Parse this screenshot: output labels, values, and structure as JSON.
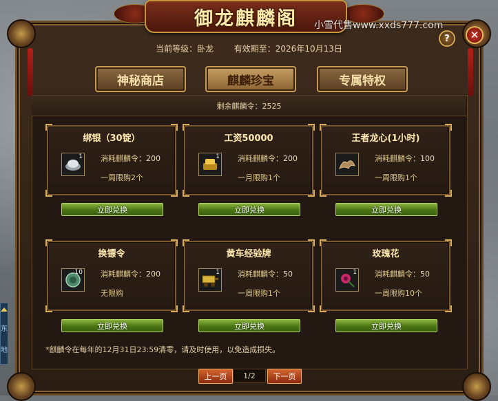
{
  "window": {
    "title": "御龙麒麟阁",
    "watermark": "小雪代售www.xxds777.com",
    "help_label": "?",
    "close_label": "✕"
  },
  "header": {
    "level_label": "当前等级：卧龙",
    "expiry_label": "有效期至：2026年10月13日"
  },
  "tabs": [
    {
      "label": "神秘商店",
      "active": false
    },
    {
      "label": "麒麟珍宝",
      "active": true
    },
    {
      "label": "专属特权",
      "active": false
    }
  ],
  "remaining": "剩余麒麟令：2525",
  "cost_prefix": "消耗麒麟令：",
  "exchange_label": "立即兑换",
  "items": [
    {
      "name": "绑银（30锭）",
      "cost": "200",
      "limit": "一周限购2个",
      "qty": "1",
      "icon": "silver-ingot-icon",
      "color": "#c9cfd6"
    },
    {
      "name": "工资50000",
      "cost": "200",
      "limit": "一月限购1个",
      "qty": "1",
      "icon": "gold-ingot-icon",
      "color": "#e2b53a"
    },
    {
      "name": "王者龙心(1小时)",
      "cost": "100",
      "limit": "一周限购1个",
      "qty": "",
      "icon": "dragon-heart-icon",
      "color": "#b08a5a"
    },
    {
      "name": "换镖令",
      "cost": "200",
      "limit": "无限购",
      "qty": "10",
      "icon": "escort-token-icon",
      "color": "#6aa888"
    },
    {
      "name": "黄车经验牌",
      "cost": "50",
      "limit": "一周限购1个",
      "qty": "1",
      "icon": "yellow-cart-icon",
      "color": "#d9b43a"
    },
    {
      "name": "玫瑰花",
      "cost": "50",
      "limit": "一周限购10个",
      "qty": "1",
      "icon": "rose-icon",
      "color": "#c8286a"
    }
  ],
  "notice": "*麒麟令在每年的12月31日23:59清零，请及时使用，以免造成损失。",
  "pager": {
    "prev_label": "上一页",
    "page": "1/2",
    "next_label": "下一页"
  },
  "side_tab": {
    "chars": [
      "东",
      "地"
    ]
  }
}
